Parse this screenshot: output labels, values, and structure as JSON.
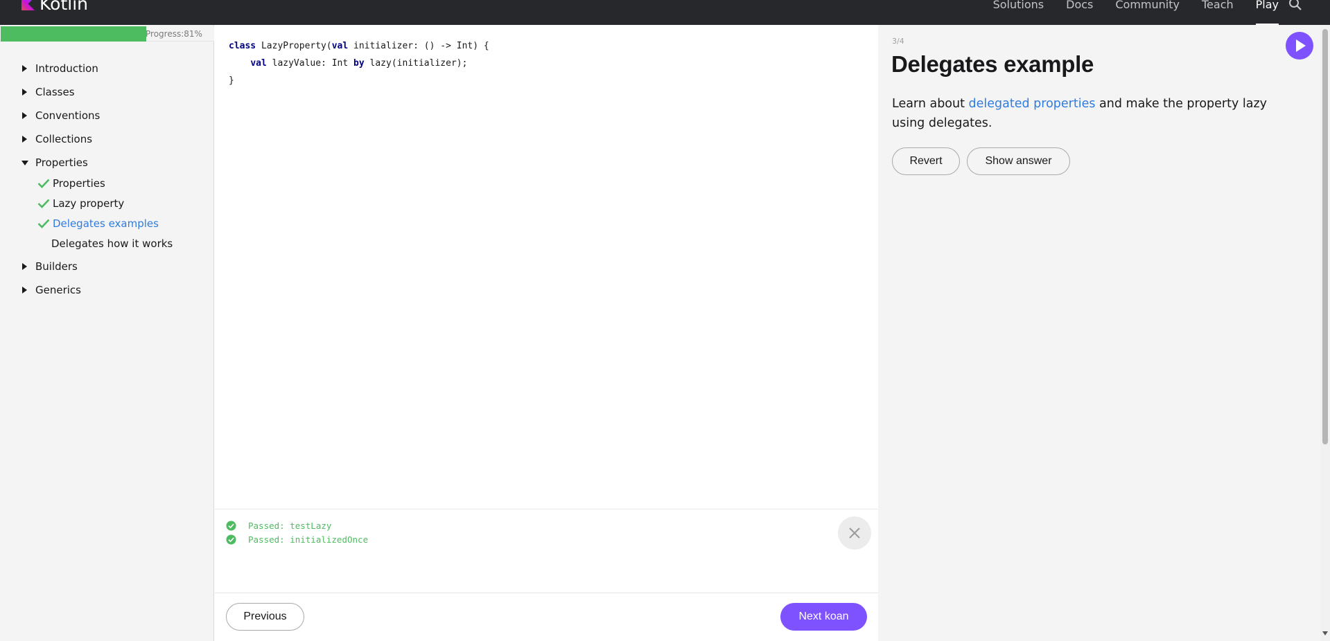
{
  "header": {
    "logo_text": "Kotlin",
    "nav": [
      "Solutions",
      "Docs",
      "Community",
      "Teach",
      "Play"
    ],
    "active_nav": "Play",
    "icons": [
      "kotlin-logo",
      "search-icon"
    ]
  },
  "sidebar": {
    "progress_label": "Progress:81%",
    "progress_fraction": 0.81,
    "sections": [
      {
        "label": "Introduction",
        "expanded": false
      },
      {
        "label": "Classes",
        "expanded": false
      },
      {
        "label": "Conventions",
        "expanded": false
      },
      {
        "label": "Collections",
        "expanded": false
      },
      {
        "label": "Properties",
        "expanded": true
      },
      {
        "label": "Builders",
        "expanded": false
      },
      {
        "label": "Generics",
        "expanded": false
      }
    ],
    "properties_items": [
      {
        "label": "Properties",
        "done": true
      },
      {
        "label": "Lazy property",
        "done": true
      },
      {
        "label": "Delegates examples",
        "done": true,
        "current": true
      },
      {
        "label": "Delegates how it works",
        "done": false
      }
    ]
  },
  "editor": {
    "code_lines": [
      "class LazyProperty(val initializer: () -> Int) {",
      "    val lazyValue: Int by lazy(initializer);",
      "}"
    ],
    "keywords": [
      "class",
      "val",
      "by"
    ]
  },
  "console": {
    "lines": [
      "Passed: testLazy",
      "Passed: initializedOnce"
    ]
  },
  "footer": {
    "previous_label": "Previous",
    "next_label": "Next koan"
  },
  "task": {
    "counter": "3/4",
    "title": "Delegates example",
    "desc_before": "Learn about ",
    "desc_link": "delegated properties",
    "desc_after": " and make the property lazy using delegates.",
    "revert_label": "Revert",
    "answer_label": "Show answer"
  },
  "colors": {
    "accent": "#7f52ff",
    "success": "#4dbb5f",
    "link": "#307bde",
    "header_bg": "#27282c"
  }
}
